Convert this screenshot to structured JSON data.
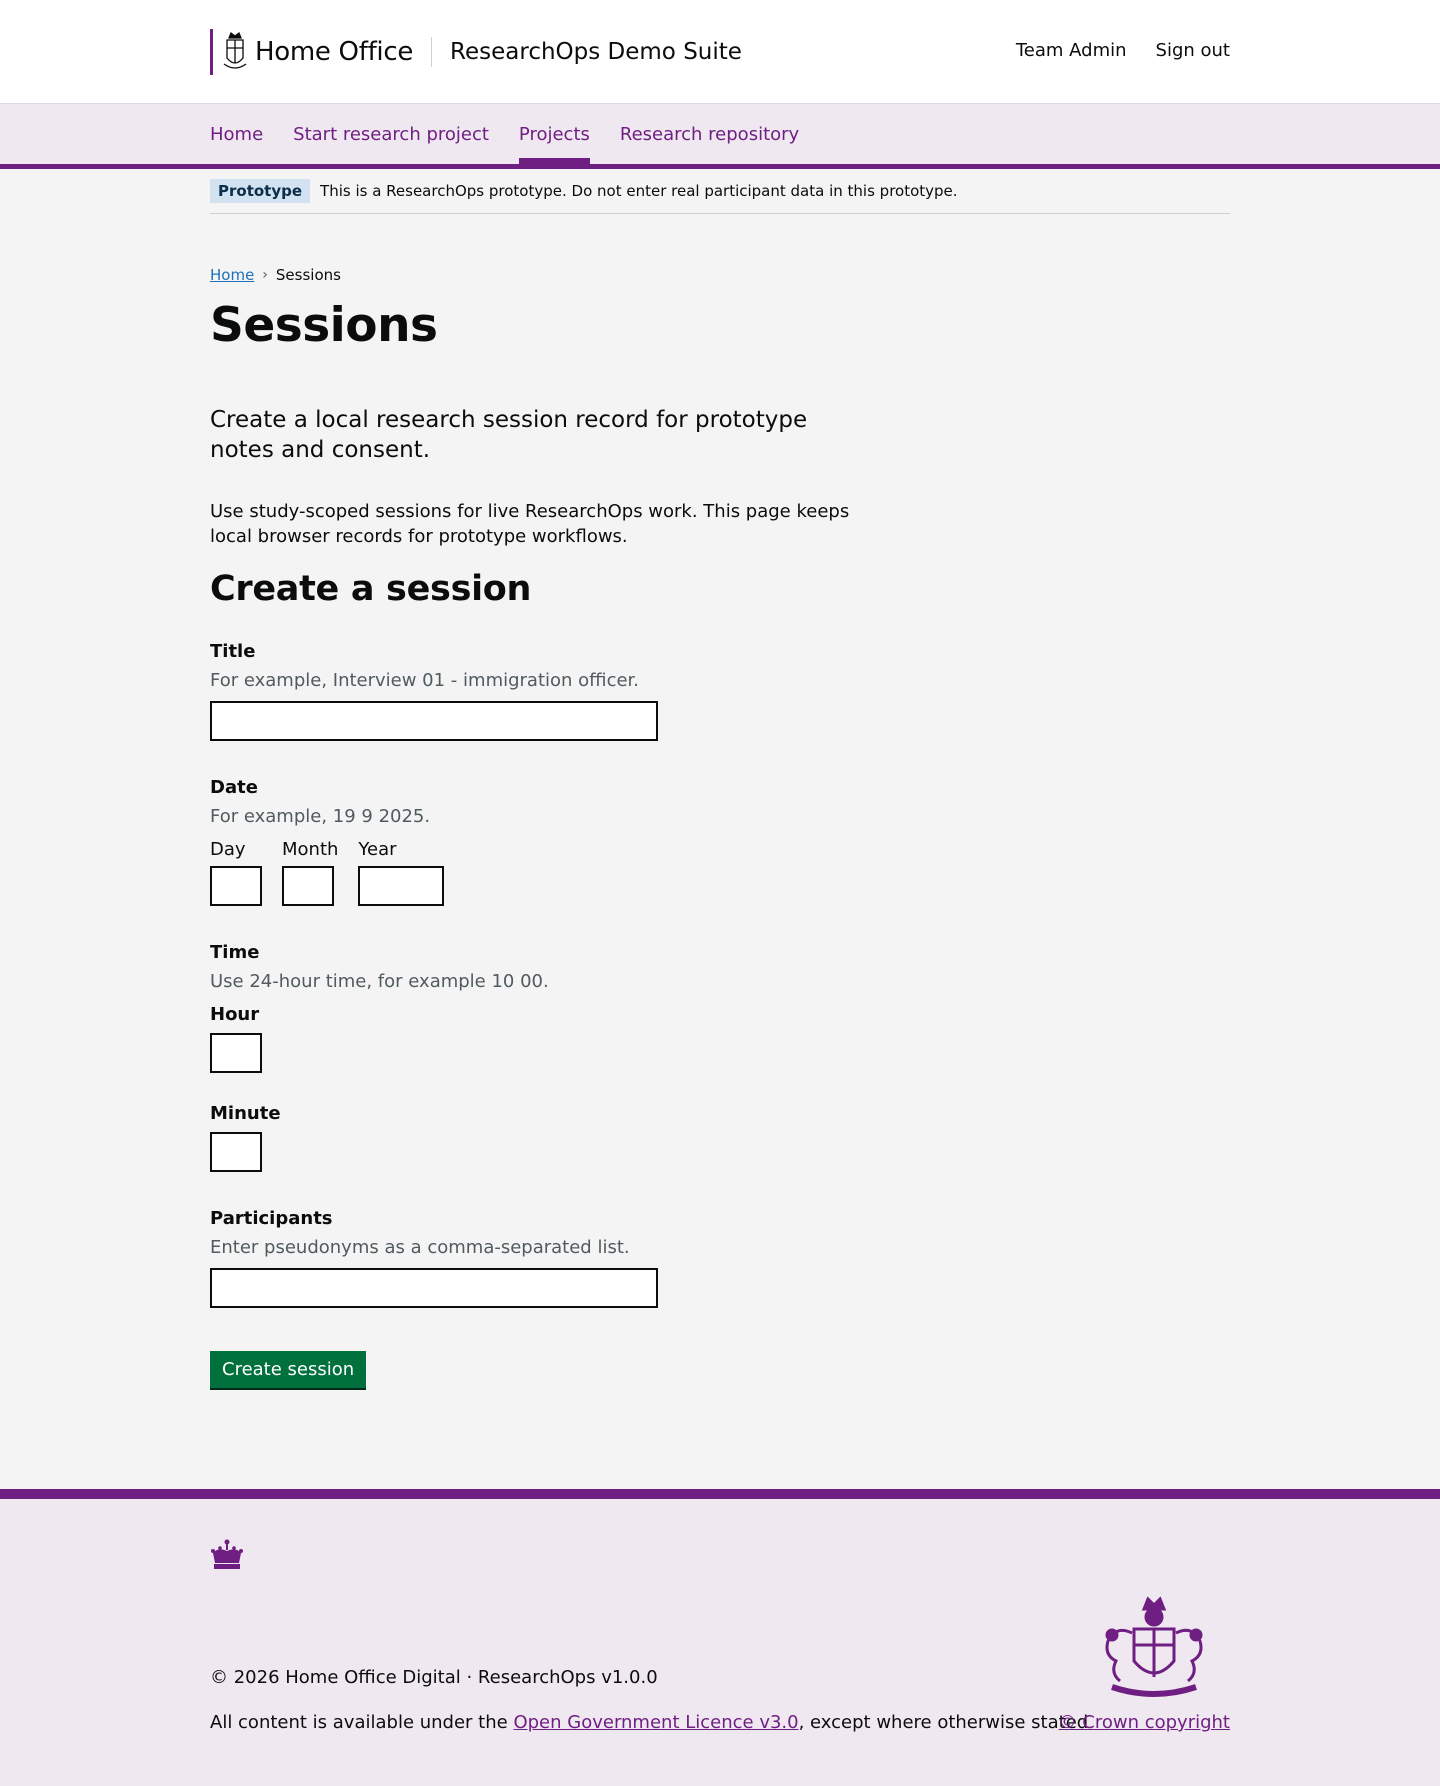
{
  "header": {
    "org_name": "Home Office",
    "service_name": "ResearchOps Demo Suite",
    "links": [
      "Team Admin",
      "Sign out"
    ]
  },
  "nav": {
    "items": [
      "Home",
      "Start research project",
      "Projects",
      "Research repository"
    ],
    "active": "Projects"
  },
  "phase_banner": {
    "tag": "Prototype",
    "text": "This is a ResearchOps prototype. Do not enter real participant data in this prototype."
  },
  "breadcrumb": {
    "home": "Home",
    "current": "Sessions"
  },
  "page": {
    "title": "Sessions",
    "lead": "Create a local research session record for prototype notes and consent.",
    "body": "Use study-scoped sessions for live ResearchOps work. This page keeps local browser records for prototype workflows.",
    "section_heading": "Create a session"
  },
  "form": {
    "title": {
      "label": "Title",
      "hint": "For example, Interview 01 - immigration officer.",
      "value": ""
    },
    "date": {
      "label": "Date",
      "hint": "For example, 19 9 2025.",
      "day": "Day",
      "month": "Month",
      "year": "Year"
    },
    "time": {
      "label": "Time",
      "hint": "Use 24-hour time, for example 10 00.",
      "hour": "Hour",
      "minute": "Minute"
    },
    "participants": {
      "label": "Participants",
      "hint": "Enter pseudonyms as a comma-separated list.",
      "value": ""
    },
    "submit": "Create session"
  },
  "footer": {
    "copyright": "© 2026 Home Office Digital · ResearchOps v1.0.0",
    "licence_prefix": "All content is available under the ",
    "licence_link": "Open Government Licence v3.0",
    "licence_suffix": ", except where otherwise stated",
    "crown_copyright": "© Crown copyright"
  },
  "colors": {
    "brand": "#6f1f82",
    "nav_background": "#f0e8f1",
    "button": "#00703c",
    "link": "#1d70b8"
  }
}
